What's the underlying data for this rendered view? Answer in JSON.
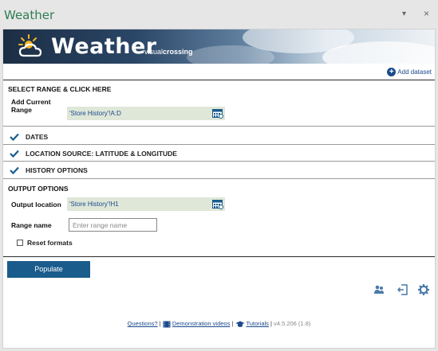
{
  "window": {
    "title": "Weather",
    "minimize_glyph": "▾",
    "close_glyph": "×"
  },
  "banner": {
    "brand": "Weather",
    "vendor_prefix": "visual",
    "vendor_suffix": "crossing"
  },
  "add_dataset_label": "Add dataset",
  "select_range": {
    "heading": "SELECT RANGE & CLICK HERE",
    "add_current_line1": "Add Current",
    "add_current_line2": "Range",
    "value": "'Store History'!A:D"
  },
  "collapsed_sections": [
    {
      "label": "DATES"
    },
    {
      "label": "LOCATION SOURCE: LATITUDE & LONGITUDE"
    },
    {
      "label": "HISTORY OPTIONS"
    }
  ],
  "output_options": {
    "heading": "OUTPUT OPTIONS",
    "location_label": "Output location",
    "location_value": "'Store History'!H1",
    "range_name_label": "Range name",
    "range_name_placeholder": "Enter range name",
    "range_name_value": "",
    "reset_formats_label": "Reset formats",
    "reset_formats_checked": false
  },
  "populate_label": "Populate",
  "footer": {
    "questions": "Questions?",
    "demo": "Demonstration videos",
    "tutorials": "Tutorials",
    "version": "v4.5.206 (1.8)",
    "sep": "|"
  },
  "colors": {
    "accent": "#1a5c8c",
    "link": "#1a4a8c",
    "field_bg": "#dfe7d8",
    "title_green": "#2e7d52"
  }
}
